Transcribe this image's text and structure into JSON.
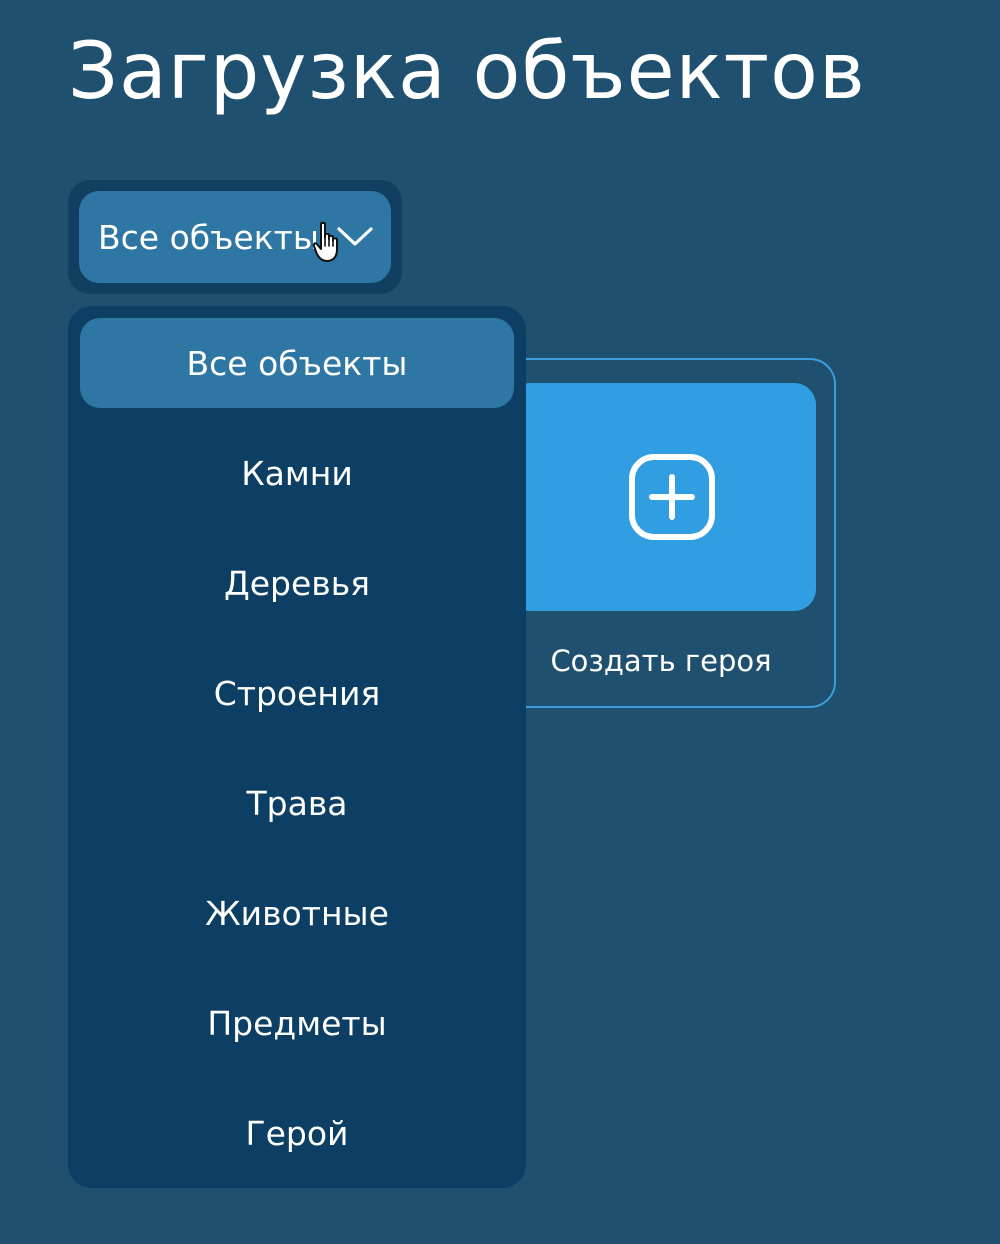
{
  "header": {
    "title": "Загрузка объектов"
  },
  "filter": {
    "selected_label": "Все объекты",
    "icon": "chevron-down-icon",
    "options": [
      {
        "label": "Все объекты",
        "selected": true
      },
      {
        "label": "Камни",
        "selected": false
      },
      {
        "label": "Деревья",
        "selected": false
      },
      {
        "label": "Строения",
        "selected": false
      },
      {
        "label": "Трава",
        "selected": false
      },
      {
        "label": "Животные",
        "selected": false
      },
      {
        "label": "Предметы",
        "selected": false
      },
      {
        "label": "Герой",
        "selected": false
      }
    ]
  },
  "create_card": {
    "label": "Создать героя",
    "icon": "plus-square-icon"
  },
  "colors": {
    "background": "#20506f",
    "dropdown_background": "#0c3f63",
    "selected_item": "#2e77a4",
    "card_tile": "#329ee2",
    "card_border": "#3a9fdc",
    "text": "#ffffff"
  }
}
